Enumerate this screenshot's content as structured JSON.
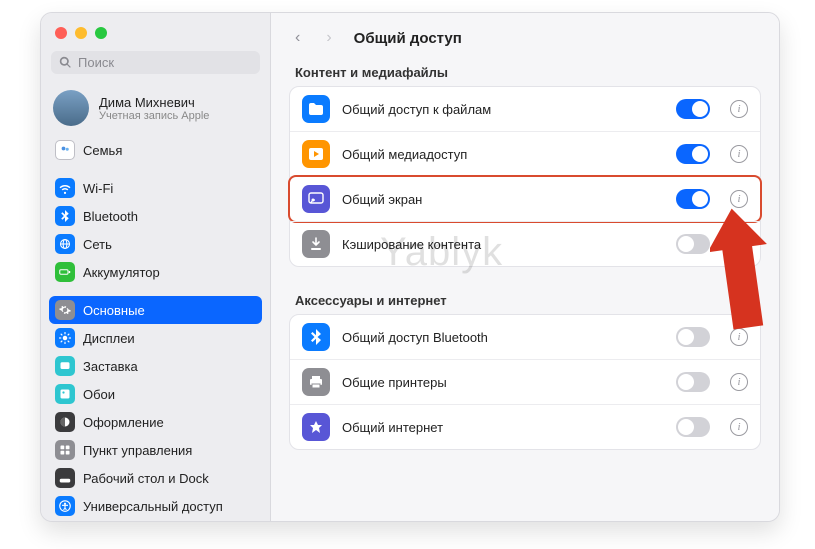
{
  "search": {
    "placeholder": "Поиск"
  },
  "account": {
    "name": "Дима Михневич",
    "sub": "Учетная запись Apple"
  },
  "sidebar": {
    "g1": [
      {
        "label": "Семья",
        "color": "#ffffff",
        "stroke": "#bfbfc6",
        "glyph": "family"
      }
    ],
    "g2": [
      {
        "label": "Wi-Fi",
        "color": "#0a7bff",
        "glyph": "wifi"
      },
      {
        "label": "Bluetooth",
        "color": "#0a7bff",
        "glyph": "bt"
      },
      {
        "label": "Сеть",
        "color": "#0a7bff",
        "glyph": "globe"
      },
      {
        "label": "Аккумулятор",
        "color": "#2fbf3a",
        "glyph": "battery"
      }
    ],
    "g3": [
      {
        "label": "Основные",
        "color": "#8e8e93",
        "glyph": "gear",
        "active": true
      },
      {
        "label": "Дисплеи",
        "color": "#0a7bff",
        "glyph": "sun"
      },
      {
        "label": "Заставка",
        "color": "#2ec6d0",
        "glyph": "screensaver"
      },
      {
        "label": "Обои",
        "color": "#2ec6d0",
        "glyph": "wall"
      },
      {
        "label": "Оформление",
        "color": "#3b3b3d",
        "glyph": "appearance"
      },
      {
        "label": "Пункт управления",
        "color": "#8e8e93",
        "glyph": "cc"
      },
      {
        "label": "Рабочий стол и Dock",
        "color": "#3b3b3d",
        "glyph": "dock"
      },
      {
        "label": "Универсальный доступ",
        "color": "#0a7bff",
        "glyph": "access"
      }
    ]
  },
  "header": {
    "title": "Общий доступ"
  },
  "content": {
    "section1": {
      "label": "Контент и медиафайлы",
      "rows": [
        {
          "label": "Общий доступ к файлам",
          "color": "#0a7bff",
          "glyph": "folder",
          "on": true
        },
        {
          "label": "Общий медиадоступ",
          "color": "#ff9500",
          "glyph": "media",
          "on": true
        },
        {
          "label": "Общий экран",
          "color": "#5856d6",
          "glyph": "screen",
          "on": true,
          "highlight": true
        },
        {
          "label": "Кэширование контента",
          "color": "#8e8e93",
          "glyph": "download",
          "on": false
        }
      ]
    },
    "section2": {
      "label": "Аксессуары и интернет",
      "rows": [
        {
          "label": "Общий доступ Bluetooth",
          "color": "#0a7bff",
          "glyph": "bt",
          "on": false
        },
        {
          "label": "Общие принтеры",
          "color": "#8e8e93",
          "glyph": "printer",
          "on": false
        },
        {
          "label": "Общий интернет",
          "color": "#5856d6",
          "glyph": "net",
          "on": false
        }
      ]
    }
  },
  "watermark": "Yablyk"
}
